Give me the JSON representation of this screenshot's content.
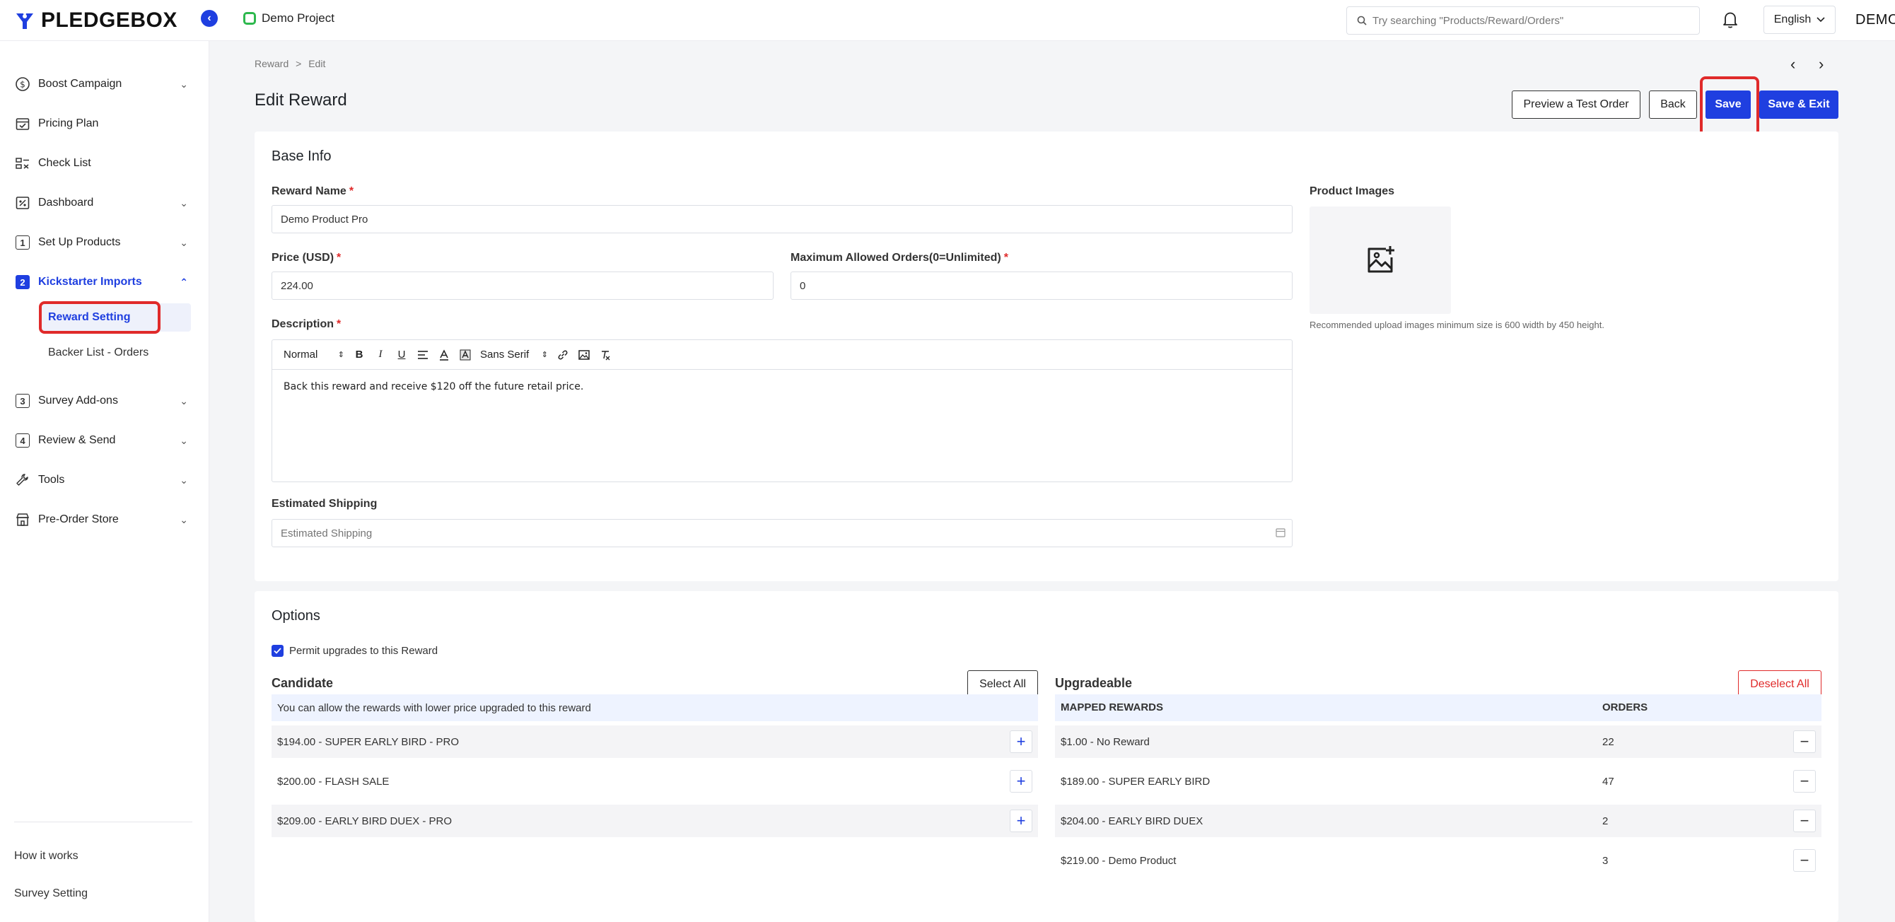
{
  "brand": {
    "name": "PLEDGEBOX"
  },
  "header": {
    "project": "Demo Project",
    "search_placeholder": "Try searching \"Products/Reward/Orders\"",
    "language": "English",
    "user": "DEMO"
  },
  "sidebar": {
    "items": [
      {
        "label": "Boost Campaign",
        "icon": "dollar-circle-icon"
      },
      {
        "label": "Pricing Plan",
        "icon": "calendar-check-icon"
      },
      {
        "label": "Check List",
        "icon": "checklist-icon"
      },
      {
        "label": "Dashboard",
        "icon": "percent-icon"
      },
      {
        "label": "Set Up Products",
        "icon": "number-1-icon",
        "num": "1"
      },
      {
        "label": "Kickstarter Imports",
        "icon": "number-2-icon",
        "num": "2"
      },
      {
        "label": "Survey Add-ons",
        "icon": "number-3-icon",
        "num": "3"
      },
      {
        "label": "Review & Send",
        "icon": "number-4-icon",
        "num": "4"
      },
      {
        "label": "Tools",
        "icon": "wrench-icon"
      },
      {
        "label": "Pre-Order Store",
        "icon": "store-icon"
      }
    ],
    "sub_items": [
      {
        "label": "Reward Setting"
      },
      {
        "label": "Backer List - Orders"
      }
    ],
    "footer": [
      {
        "label": "How it works"
      },
      {
        "label": "Survey Setting"
      }
    ]
  },
  "breadcrumb": {
    "root": "Reward",
    "sep": ">",
    "current": "Edit"
  },
  "page": {
    "title": "Edit Reward"
  },
  "actions": {
    "preview": "Preview a Test Order",
    "back": "Back",
    "save": "Save",
    "save_exit": "Save & Exit"
  },
  "base_info": {
    "title": "Base Info",
    "reward_name_label": "Reward Name",
    "reward_name_value": "Demo Product Pro",
    "price_label": "Price (USD)",
    "price_value": "224.00",
    "max_orders_label": "Maximum Allowed Orders(0=Unlimited)",
    "max_orders_value": "0",
    "description_label": "Description",
    "editor_format": "Normal",
    "editor_font": "Sans Serif",
    "description_text": "Back this reward and receive $120 off the future retail price.",
    "shipping_label": "Estimated Shipping",
    "shipping_placeholder": "Estimated Shipping",
    "product_images_label": "Product Images",
    "image_hint": "Recommended upload images minimum size is 600 width by 450 height.",
    "required_mark": "*"
  },
  "options": {
    "title": "Options",
    "permit_label": "Permit upgrades to this Reward",
    "candidate_title": "Candidate",
    "select_all": "Select All",
    "candidate_info": "You can allow the rewards with lower price upgraded to this reward",
    "candidates": [
      {
        "label": "$194.00 - SUPER EARLY BIRD - PRO"
      },
      {
        "label": "$200.00 - FLASH SALE"
      },
      {
        "label": "$209.00 - EARLY BIRD DUEX - PRO"
      }
    ],
    "upgradeable_title": "Upgradeable",
    "deselect_all": "Deselect All",
    "col_mapped": "MAPPED REWARDS",
    "col_orders": "ORDERS",
    "upgradeable": [
      {
        "label": "$1.00 - No Reward",
        "orders": "22"
      },
      {
        "label": "$189.00 - SUPER EARLY BIRD",
        "orders": "47"
      },
      {
        "label": "$204.00 - EARLY BIRD DUEX",
        "orders": "2"
      },
      {
        "label": "$219.00 - Demo Product",
        "orders": "3"
      }
    ]
  },
  "colors": {
    "accent": "#1f3fe0",
    "highlight": "#e02a2a",
    "required": "#e02a2a"
  }
}
